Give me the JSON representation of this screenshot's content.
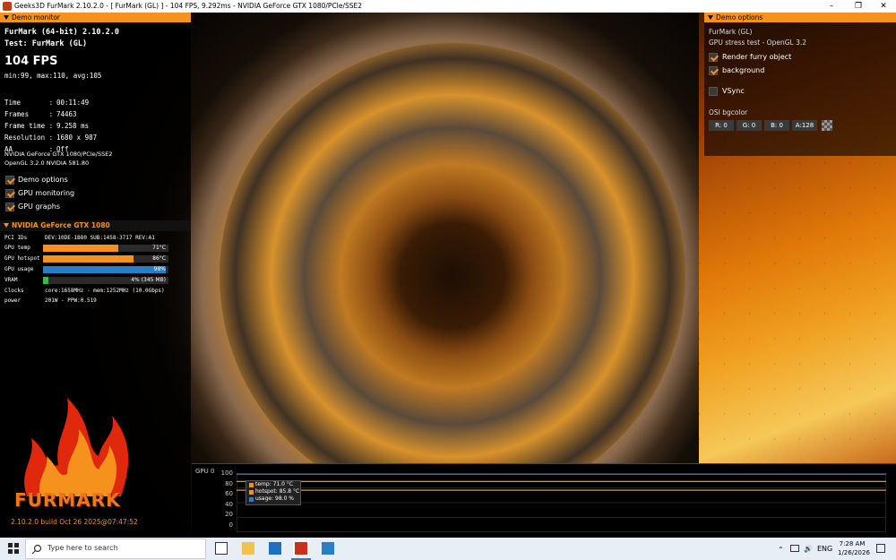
{
  "window": {
    "title": "Geeks3D FurMark 2.10.2.0 - [ FurMark (GL) ] - 104 FPS, 9.292ms - NVIDIA GeForce GTX 1080/PCIe/SSE2",
    "minimize": "–",
    "maximize": "❐",
    "close": "✕"
  },
  "demo_monitor": {
    "header": "Demo monitor",
    "app_name": "FurMark (64-bit) 2.10.2.0",
    "test": "Test: FurMark (GL)",
    "fps": "104 FPS",
    "fps_stats": "min:99, max:110, avg:105",
    "stats": [
      {
        "label": "Time       :",
        "value": "00:11:49"
      },
      {
        "label": "Frames     :",
        "value": "74463"
      },
      {
        "label": "Frame time :",
        "value": "9.258 ms"
      },
      {
        "label": "Resolution :",
        "value": "1680 x 987"
      },
      {
        "label": "AA         :",
        "value": "Off"
      }
    ],
    "renderer": "NVIDIA GeForce GTX 1080/PCIe/SSE2",
    "gl_version": "OpenGL 3.2.0 NVIDIA 581.80",
    "checkboxes": [
      {
        "label": "Demo options",
        "checked": true
      },
      {
        "label": "GPU monitoring",
        "checked": true
      },
      {
        "label": "GPU graphs",
        "checked": true
      }
    ]
  },
  "gpu": {
    "header": "NVIDIA GeForce GTX 1080",
    "pci_label": "PCI IDs",
    "pci_value": "DEV:10DE-1B80 SUB:1458-3717 REV:A1",
    "bars": [
      {
        "label": "GPU temp",
        "value": "71°C",
        "fraction": 0.6,
        "color": "#f5921e"
      },
      {
        "label": "GPU hotspot",
        "value": "86°C",
        "fraction": 0.72,
        "color": "#f5921e"
      },
      {
        "label": "GPU usage",
        "value": "98%",
        "fraction": 0.98,
        "color": "#2a7fc4"
      },
      {
        "label": "VRAM",
        "value": "4% (345 MB)",
        "fraction": 0.04,
        "color": "#3bb84a"
      }
    ],
    "clocks_label": "Clocks",
    "clocks_value": "core:1658MHz - mem:1252MHz (10.0Gbps)",
    "power_label": "power",
    "power_value": "201W - PPW:0.519"
  },
  "logo": {
    "text": "FURMARK",
    "build": "2.10.2.0 build Oct 26 2025@07:47:52"
  },
  "demo_options": {
    "header": "Demo options",
    "name": "FurMark (GL)",
    "subtitle": "GPU stress test - OpenGL 3.2",
    "checkboxes": [
      {
        "label": "Render furry object",
        "checked": true
      },
      {
        "label": "background",
        "checked": true
      },
      {
        "label": "VSync",
        "checked": false
      }
    ],
    "osi_label": "OSI bgcolor",
    "osi": [
      {
        "label": "R: 0"
      },
      {
        "label": "G: 0"
      },
      {
        "label": "B: 0"
      },
      {
        "label": "A:128"
      }
    ]
  },
  "graph": {
    "title": "GPU 0",
    "y_ticks": [
      "100",
      "80",
      "60",
      "40",
      "20",
      "0"
    ],
    "legend": [
      {
        "label": "temp: 71.0 °C",
        "color": "#f5921e"
      },
      {
        "label": "hotspot: 85.8 °C",
        "color": "#f5921e"
      },
      {
        "label": "usage: 98.0 %",
        "color": "#2a7fc4"
      }
    ],
    "series": [
      {
        "value": 98,
        "color": "#2a7fc4"
      },
      {
        "value": 85.8,
        "color": "#f5921e"
      },
      {
        "value": 71,
        "color": "#f5921e"
      }
    ]
  },
  "taskbar": {
    "search_placeholder": "Type here to search",
    "lang": "ENG",
    "time": "7:28 AM",
    "date": "1/26/2026"
  }
}
